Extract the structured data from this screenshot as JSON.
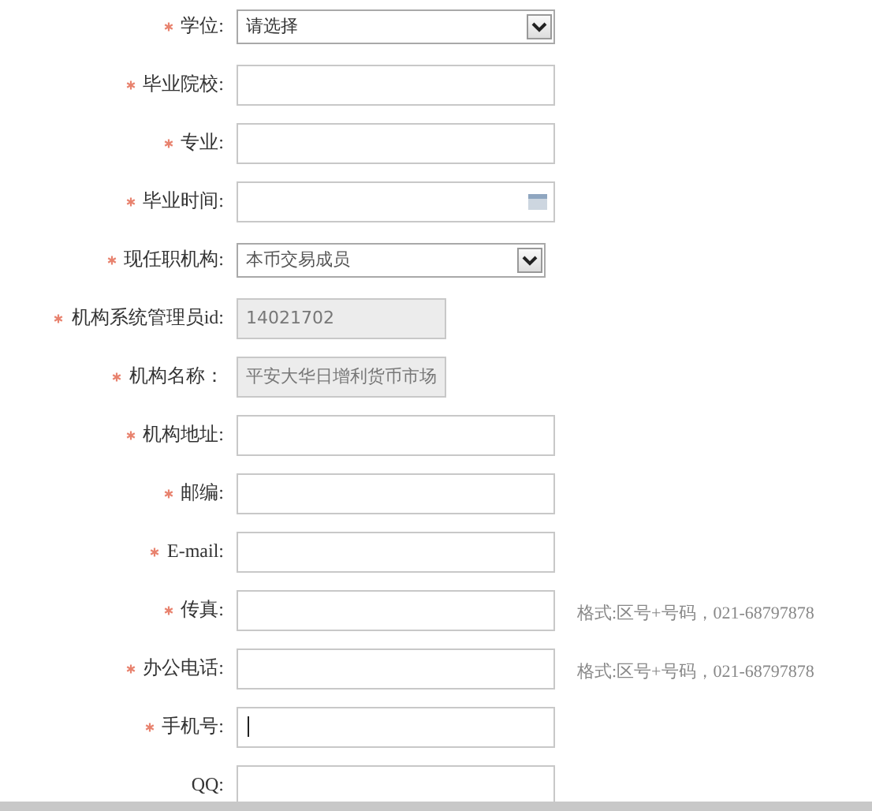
{
  "form_rows": [
    {
      "label": "学位:",
      "required": true,
      "kind": "select",
      "value": "请选择",
      "narrow": false
    },
    {
      "label": "毕业院校:",
      "required": true,
      "kind": "text"
    },
    {
      "label": "专业:",
      "required": true,
      "kind": "text"
    },
    {
      "label": "毕业时间:",
      "required": true,
      "kind": "date"
    },
    {
      "label": "现任职机构:",
      "required": true,
      "kind": "select",
      "value": "本币交易成员",
      "narrow": true
    },
    {
      "label": "机构系统管理员id:",
      "required": true,
      "kind": "readonly",
      "value": "14021702"
    },
    {
      "label": "机构名称：",
      "required": true,
      "kind": "readonly",
      "value": "平安大华日增利货币市场"
    },
    {
      "label": "机构地址:",
      "required": true,
      "kind": "text"
    },
    {
      "label": "邮编:",
      "required": true,
      "kind": "text"
    },
    {
      "label": "E-mail:",
      "required": true,
      "kind": "text"
    },
    {
      "label": "传真:",
      "required": true,
      "kind": "text",
      "hint": "格式:区号+号码，021-68797878"
    },
    {
      "label": "办公电话:",
      "required": true,
      "kind": "text",
      "hint": "格式:区号+号码，021-68797878"
    },
    {
      "label": "手机号:",
      "required": true,
      "kind": "text",
      "focused": true
    },
    {
      "label": "QQ:",
      "required": false,
      "kind": "text"
    }
  ]
}
